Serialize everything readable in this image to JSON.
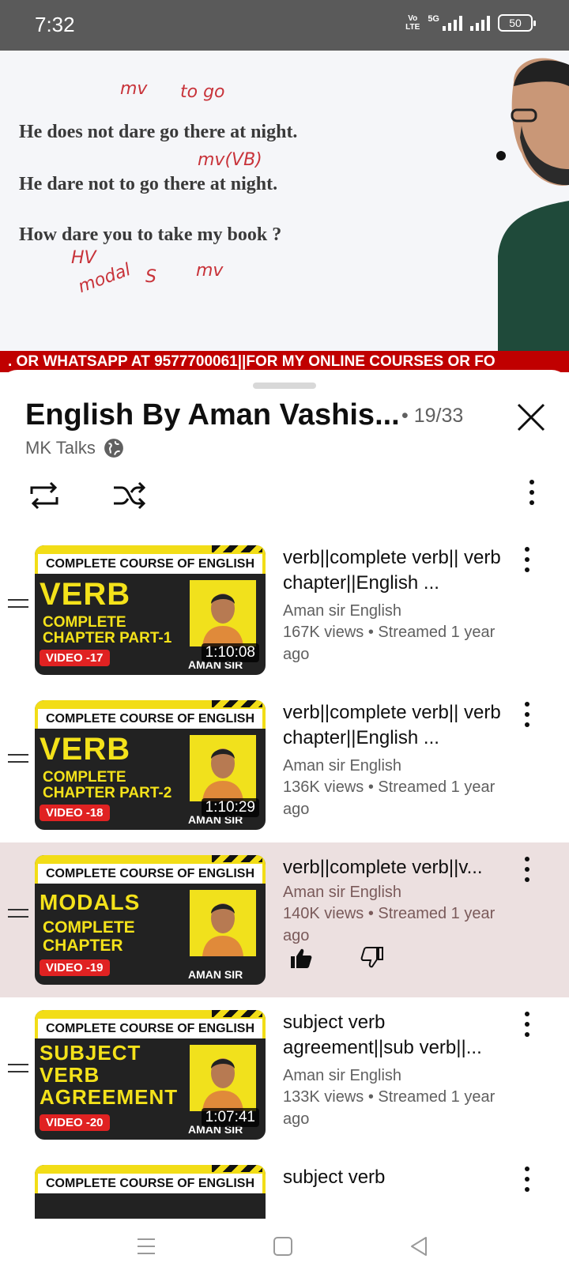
{
  "status": {
    "time": "7:32",
    "volte_top": "Vo",
    "volte_mid": "LTE",
    "net": "5G",
    "battery": "50"
  },
  "video": {
    "lines": [
      "He does not dare go there at night.",
      "He dare not to go there at night.",
      "How dare you to take my book ?"
    ],
    "ink": [
      "mv",
      "to go",
      "mv(VB)",
      "HV",
      "modal",
      "S",
      "mv"
    ],
    "ticker": ". OR WHATSAPP AT 9577700061||FOR MY ONLINE COURSES OR FO"
  },
  "playlist": {
    "title": "English By Aman Vashis...",
    "count": "• 19/33",
    "channel": "MK Talks"
  },
  "videos": [
    {
      "thumb_header": "COMPLETE COURSE OF ENGLISH",
      "thumb_big": "VERB",
      "thumb_sub1": "COMPLETE",
      "thumb_sub2": "CHAPTER PART-1",
      "thumb_video": "VIDEO -17",
      "thumb_name": "AMAN SIR",
      "duration": "1:10:08",
      "title": "verb||complete verb|| verb chapter||English ...",
      "channel": "Aman sir English",
      "meta": "167K views • Streamed 1 year ago"
    },
    {
      "thumb_header": "COMPLETE COURSE OF ENGLISH",
      "thumb_big": "VERB",
      "thumb_sub1": "COMPLETE",
      "thumb_sub2": "CHAPTER PART-2",
      "thumb_video": "VIDEO -18",
      "thumb_name": "AMAN SIR",
      "duration": "1:10:29",
      "title": "verb||complete verb|| verb chapter||English ...",
      "channel": "Aman sir English",
      "meta": "136K views • Streamed 1 year ago"
    },
    {
      "thumb_header": "COMPLETE COURSE OF ENGLISH",
      "thumb_big": "MODALS",
      "thumb_sub1": "COMPLETE",
      "thumb_sub2": "CHAPTER",
      "thumb_video": "VIDEO -19",
      "thumb_name": "AMAN SIR",
      "title": "verb||complete verb||v...",
      "channel": "Aman sir English",
      "meta": "140K views • Streamed 1 year ago"
    },
    {
      "thumb_header": "COMPLETE COURSE OF ENGLISH",
      "thumb_big1": "SUBJECT",
      "thumb_big2": "VERB",
      "thumb_big3": "AGREEMENT",
      "thumb_video": "VIDEO -20",
      "thumb_name": "AMAN SIR",
      "duration": "1:07:41",
      "title": "subject verb agreement||sub verb||...",
      "channel": "Aman sir English",
      "meta": "133K views • Streamed 1 year ago"
    },
    {
      "thumb_header": "COMPLETE COURSE OF ENGLISH",
      "title": "subject verb"
    }
  ],
  "colors": {
    "active_row": "#ece0e0",
    "thumb_yellow": "#f2dd17",
    "ticker_red": "#c00000"
  },
  "icons": [
    "repeat-icon",
    "shuffle-icon",
    "more-vert-icon",
    "close-icon",
    "globe-icon",
    "like-icon",
    "dislike-icon",
    "drag-handle-icon",
    "nav-menu-icon",
    "nav-home-icon",
    "nav-back-icon"
  ]
}
